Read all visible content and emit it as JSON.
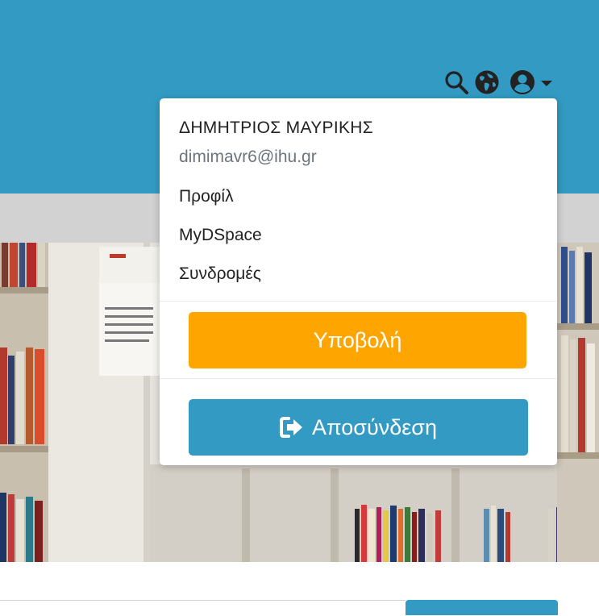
{
  "header": {
    "icons": [
      "search-icon",
      "globe-icon",
      "user-circle-icon",
      "caret-down-icon"
    ]
  },
  "user_menu": {
    "name": "ΔΗΜΗΤΡΙΟΣ ΜΑΥΡΙΚΗΣ",
    "email": "dimimavr6@ihu.gr",
    "items": [
      "Προφίλ",
      "MyDSpace",
      "Συνδρομές"
    ],
    "submit_label": "Υποβολή",
    "logout_label": "Αποσύνδεση",
    "logout_icon": "sign-out-icon"
  },
  "colors": {
    "header": "#339bc3",
    "submit_button": "#ffa500",
    "logout_button": "#339bc3",
    "subbar": "#d2d2d2"
  }
}
